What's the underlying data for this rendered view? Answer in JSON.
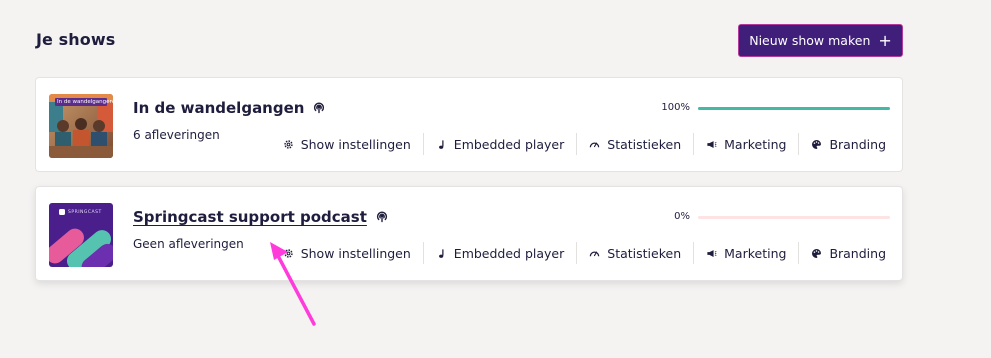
{
  "page": {
    "title": "Je shows"
  },
  "header": {
    "new_show_label": "Nieuw show maken",
    "new_show_icon": "plus-icon"
  },
  "shows": [
    {
      "title": "In de wandelgangen",
      "cover_text": "In de wandelgangen",
      "episodes": "6 afleveringen",
      "progress_label": "100%",
      "progress": 100
    },
    {
      "title": "Springcast support podcast",
      "cover_text": "SPRINGCAST",
      "episodes": "Geen afleveringen",
      "progress_label": "0%",
      "progress": 0
    }
  ],
  "actions": [
    {
      "label": "Show instellingen",
      "icon": "gear-icon"
    },
    {
      "label": "Embedded player",
      "icon": "music-note-icon"
    },
    {
      "label": "Statistieken",
      "icon": "gauge-icon"
    },
    {
      "label": "Marketing",
      "icon": "megaphone-icon"
    },
    {
      "label": "Branding",
      "icon": "palette-icon"
    }
  ],
  "colors": {
    "accent": "#3f1f7a",
    "accent_border": "#b23a9c",
    "progress": "#44b8a2",
    "progress_track": "#fde3e3",
    "annotation_arrow": "#ff3bdc"
  }
}
